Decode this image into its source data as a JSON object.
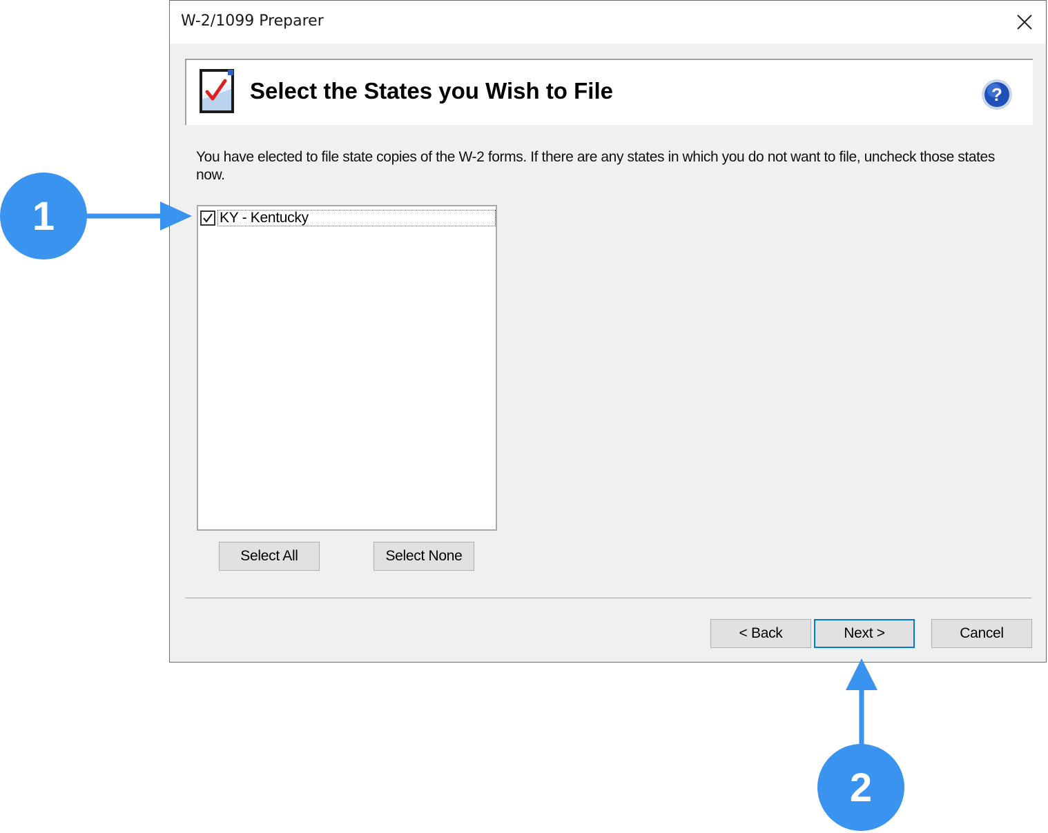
{
  "window": {
    "title": "W-2/1099 Preparer",
    "close_icon": "close-icon"
  },
  "header": {
    "icon": "document-checkmark-icon",
    "title": "Select the States you Wish to File",
    "help_icon": "help-icon"
  },
  "instruction": "You have elected to file state copies of the W-2 forms. If there are any states in which you do not want to file,  uncheck those states now.",
  "states": [
    {
      "label": "KY - Kentucky",
      "checked": true
    }
  ],
  "list_buttons": {
    "select_all": "Select All",
    "select_none": "Select None"
  },
  "footer": {
    "back": "< Back",
    "next": "Next >",
    "cancel": "Cancel"
  },
  "callouts": {
    "one": "1",
    "two": "2"
  },
  "colors": {
    "accent": "#3b93f0",
    "primary_border": "#0078d7",
    "dialog_bg": "#f0f0f0"
  }
}
